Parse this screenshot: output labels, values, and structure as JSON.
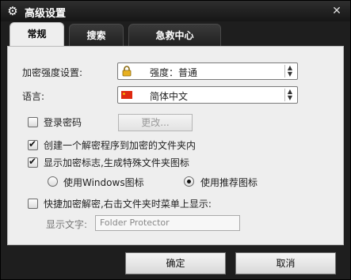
{
  "window": {
    "title": "高级设置",
    "close_glyph": "✕"
  },
  "tabs": [
    {
      "label": "常规"
    },
    {
      "label": "搜索"
    },
    {
      "label": "急救中心"
    }
  ],
  "general": {
    "encryption_label": "加密强度设置:",
    "encryption_value": "强度：普通",
    "language_label": "语言:",
    "language_value": "简体中文",
    "login_password_label": "登录密码",
    "login_password_checked": false,
    "change_button": "更改...",
    "create_decryptor_label": "创建一个解密程序到加密的文件夹内",
    "create_decryptor_checked": true,
    "show_mark_label": "显示加密标志,生成特殊文件夹图标",
    "show_mark_checked": true,
    "icon_option_windows": "使用Windows图标",
    "icon_option_recommended": "使用推荐图标",
    "icon_option_selected": "recommended",
    "quick_menu_label": "快捷加密解密,右击文件夹时菜单上显示:",
    "quick_menu_checked": false,
    "display_text_label": "显示文字:",
    "display_text_value": "Folder Protector"
  },
  "footer": {
    "ok": "确定",
    "cancel": "取消"
  }
}
